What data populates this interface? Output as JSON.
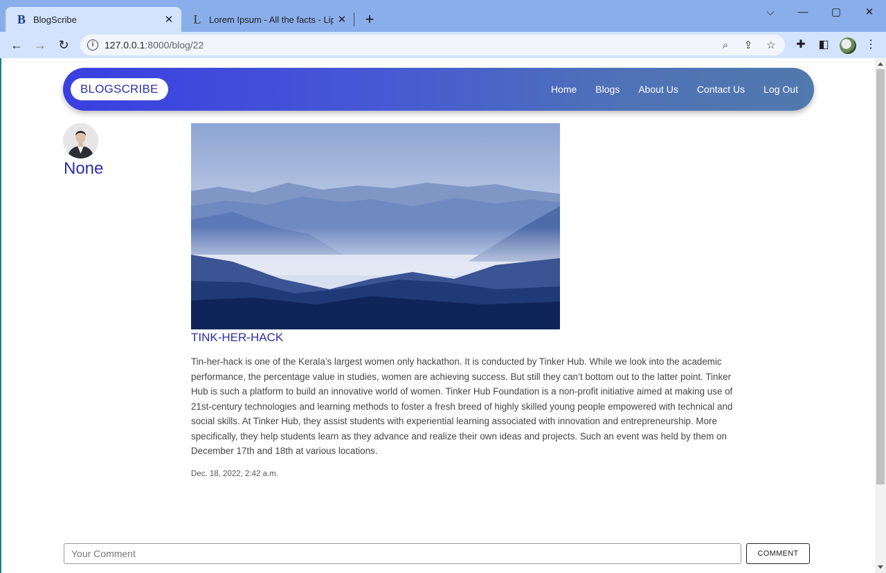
{
  "browser": {
    "tabs": [
      {
        "title": "BlogScribe",
        "favicon": "B",
        "active": true
      },
      {
        "title": "Lorem Ipsum - All the facts - Lips",
        "favicon": "L",
        "active": false
      }
    ],
    "url_host": "127.0.0.1",
    "url_rest": ":8000/blog/22",
    "new_tab": "+",
    "close_glyph": "✕",
    "window_controls": {
      "dropdown": "⌵",
      "minimize": "—",
      "maximize": "▢",
      "close": "✕"
    },
    "icons": {
      "back": "←",
      "forward": "→",
      "reload": "↻",
      "zoom": "⌕",
      "share": "⇪",
      "star": "☆",
      "extensions": "✚",
      "sidepanel": "◧",
      "menu": "⋮",
      "info": "i"
    }
  },
  "site": {
    "brand": "BLOGSCRIBE",
    "nav": [
      "Home",
      "Blogs",
      "About Us",
      "Contact Us",
      "Log Out"
    ],
    "accent": "#2b2ea8"
  },
  "post": {
    "author": "None",
    "title": "TINK-HER-HACK",
    "body": "Tin-her-hack is one of the Kerala’s largest women only hackathon. It is conducted by Tinker Hub. While we look into the academic performance, the percentage value in studies, women are achieving success.  But still they can’t bottom out to the latter point. Tinker Hub is such a platform to build an innovative world of women.  Tinker Hub Foundation is a non-profit initiative aimed at making use of 21st-century technologies and learning methods to foster a fresh breed of highly skilled young people empowered with technical and social skills. At Tinker Hub, they assist students with experiential learning associated with innovation and entrepreneurship. More specifically, they help students learn as they advance and realize their own ideas and projects. Such an event was held by them on December 17th and 18th at various locations.",
    "date": "Dec. 18, 2022, 2:42 a.m."
  },
  "comment": {
    "placeholder": "Your Comment",
    "value": "",
    "button": "COMMENT"
  }
}
